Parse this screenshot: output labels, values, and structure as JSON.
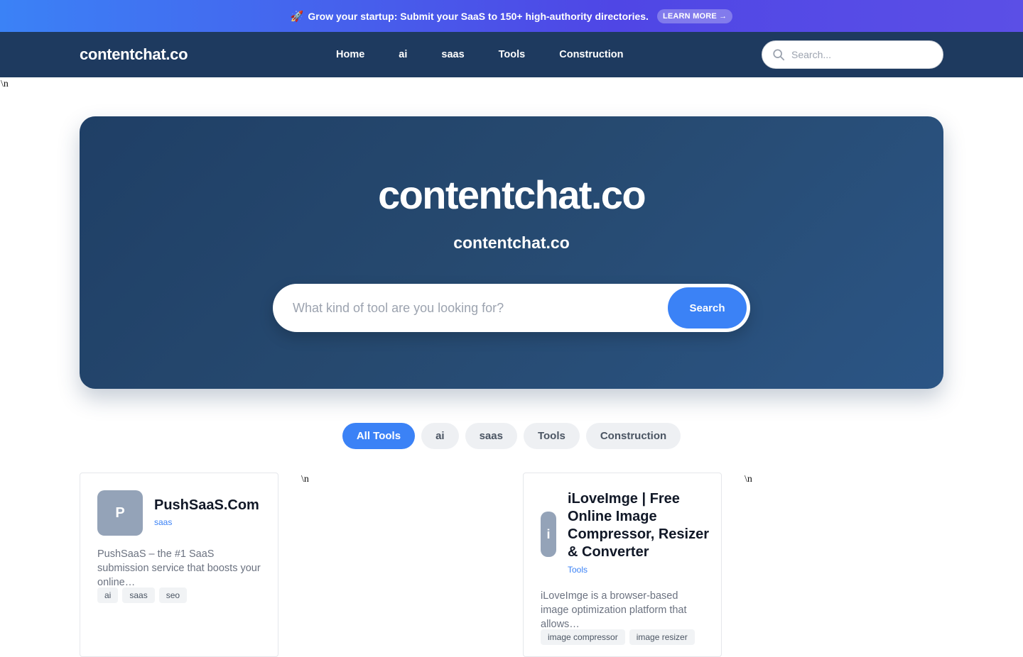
{
  "promo": {
    "icon": "rocket-icon",
    "text": "Grow your startup: Submit your SaaS to 150+ high-authority directories.",
    "cta": "LEARN MORE →"
  },
  "nav": {
    "logo": "contentchat.co",
    "links": [
      "Home",
      "ai",
      "saas",
      "Tools",
      "Construction"
    ],
    "search_placeholder": "Search..."
  },
  "stray_text": "\\n",
  "hero": {
    "title": "contentchat.co",
    "subtitle": "contentchat.co",
    "search_placeholder": "What kind of tool are you looking for?",
    "search_button": "Search"
  },
  "filters": [
    "All Tools",
    "ai",
    "saas",
    "Tools",
    "Construction"
  ],
  "active_filter": "All Tools",
  "cards": [
    {
      "initial": "P",
      "name": "PushSaaS.Com",
      "category": "saas",
      "description": "PushSaaS – the #1 SaaS submission service that boosts your online…",
      "tags": [
        "ai",
        "saas",
        "seo"
      ]
    },
    {
      "initial": "i",
      "name": "iLoveImge | Free Online Image Compressor, Resizer & Converter",
      "category": "Tools",
      "description": "iLoveImge is a browser-based image optimization platform that allows…",
      "tags": [
        "image compressor",
        "image resizer"
      ]
    }
  ],
  "colors": {
    "accent": "#3b82f6",
    "nav_bg": "#1e3a5f",
    "hero_bg": "#26496f"
  }
}
